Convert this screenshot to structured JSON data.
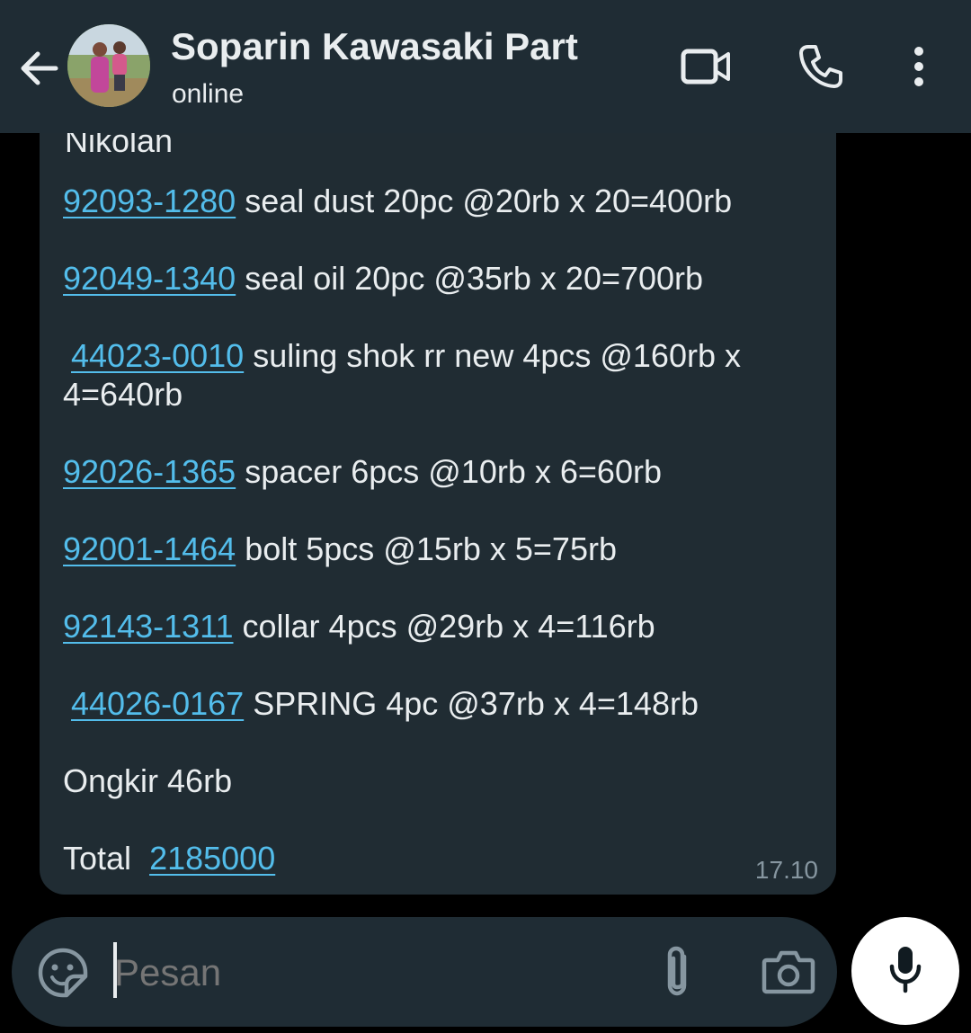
{
  "header": {
    "contact_name": "Soparin Kawasaki Part",
    "status": "online",
    "icons": [
      "back-arrow-icon",
      "video-call-icon",
      "voice-call-icon",
      "more-options-icon"
    ]
  },
  "message": {
    "cut_off_text": "Nikolan",
    "items": [
      {
        "code": "92093-1280",
        "text": " seal dust 20pc @20rb x 20=400rb"
      },
      {
        "code": "92049-1340",
        "text": " seal oil 20pc @35rb x 20=700rb"
      },
      {
        "code": "44023-0010",
        "text": " suling shok rr new 4pcs @160rb x",
        "continuation": "4=640rb"
      },
      {
        "code": "92026-1365",
        "text": " spacer  6pcs @10rb x 6=60rb"
      },
      {
        "code": "92001-1464",
        "text": " bolt 5pcs @15rb x 5=75rb"
      },
      {
        "code": "92143-1311",
        "text": " collar 4pcs @29rb x 4=116rb"
      },
      {
        "code": "44026-0167",
        "text": " SPRING 4pc @37rb x 4=148rb"
      }
    ],
    "shipping": "Ongkir 46rb",
    "total_label": "Total ",
    "total_value": "2185000",
    "time": "17.10"
  },
  "composer": {
    "placeholder": "Pesan",
    "icons": [
      "sticker-icon",
      "attach-icon",
      "camera-icon",
      "mic-icon"
    ]
  },
  "colors": {
    "header_bg": "#1f2c34",
    "bubble_bg": "#202c33",
    "link": "#53bdeb",
    "text": "#e9edef",
    "muted": "#8696a0"
  }
}
